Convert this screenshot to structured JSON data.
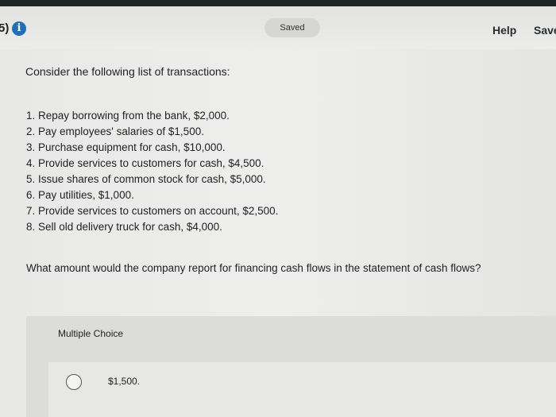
{
  "header": {
    "question_number": "5)",
    "info_icon": "info-icon",
    "info_glyph": "i",
    "saved_label": "Saved",
    "help_label": "Help",
    "save_label": "Save"
  },
  "question": {
    "intro": "Consider the following list of transactions:",
    "transactions": [
      "1. Repay borrowing from the bank, $2,000.",
      "2. Pay employees' salaries of $1,500.",
      "3. Purchase equipment for cash, $10,000.",
      "4. Provide services to customers for cash, $4,500.",
      "5. Issue shares of common stock for cash, $5,000.",
      "6. Pay utilities, $1,000.",
      "7. Provide services to customers on account, $2,500.",
      "8. Sell old delivery truck for cash, $4,000."
    ],
    "prompt": "What amount would the company report for financing cash flows in the statement of cash flows?"
  },
  "multiple_choice": {
    "label": "Multiple Choice",
    "options": [
      {
        "text": "$1,500."
      }
    ]
  },
  "colors": {
    "info_blue": "#1f6fb5",
    "top_border": "#1f2326"
  }
}
